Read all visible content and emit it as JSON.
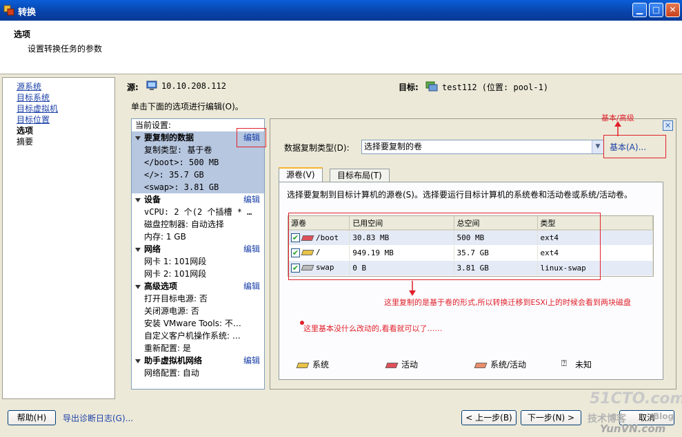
{
  "window": {
    "title": "转换",
    "colors": {
      "titlebar": "#0a5fd8",
      "link": "#1a3fa8",
      "annotation": "#e0202a"
    }
  },
  "header": {
    "title": "选项",
    "subtitle": "设置转换任务的参数"
  },
  "nav": {
    "items": [
      {
        "label": "源系统",
        "state": "link"
      },
      {
        "label": "目标系统",
        "state": "link"
      },
      {
        "label": "目标虚拟机",
        "state": "link"
      },
      {
        "label": "目标位置",
        "state": "link"
      },
      {
        "label": "选项",
        "state": "current"
      },
      {
        "label": "摘要",
        "state": "plain"
      }
    ]
  },
  "source": {
    "label": "源:",
    "value": "10.10.208.112"
  },
  "target": {
    "label": "目标:",
    "value": "test112 (位置: pool-1)"
  },
  "instruction": "单击下面的选项进行编辑(O)。",
  "settings": {
    "header": "当前设置:",
    "edit_label": "编辑",
    "sections": [
      {
        "title": "要复制的数据",
        "editable": true,
        "highlighted": true,
        "lines": [
          "复制类型: 基于卷",
          "</boot>: 500 MB",
          "</>: 35.7 GB",
          "<swap>: 3.81 GB"
        ]
      },
      {
        "title": "设备",
        "editable": true,
        "highlighted": false,
        "lines": [
          "vCPU: 2 个(2 个插槽 * …",
          "磁盘控制器: 自动选择",
          "内存: 1 GB"
        ]
      },
      {
        "title": "网络",
        "editable": true,
        "highlighted": false,
        "lines": [
          "网卡 1: 101网段",
          "网卡 2: 101网段"
        ]
      },
      {
        "title": "高级选项",
        "editable": true,
        "highlighted": false,
        "lines": [
          "打开目标电源: 否",
          "关闭源电源: 否",
          "安装 VMware Tools: 不…",
          "自定义客户机操作系统: …",
          "重新配置: 是"
        ]
      },
      {
        "title": "助手虚拟机网络",
        "editable": true,
        "highlighted": false,
        "lines": [
          "网络配置: 自动"
        ]
      }
    ]
  },
  "panel": {
    "copy_type_label": "数据复制类型(D):",
    "copy_type_value": "选择要复制的卷",
    "mode_button": "基本(A)...",
    "tabs": [
      {
        "label": "源卷(V)",
        "active": true
      },
      {
        "label": "目标布局(T)",
        "active": false
      }
    ],
    "description": "选择要复制到目标计算机的源卷(S)。选择要运行目标计算机的系统卷和活动卷或系统/活动卷。",
    "columns": [
      "源卷",
      "已用空间",
      "总空间",
      "类型"
    ],
    "rows": [
      {
        "checked": true,
        "name": "/boot",
        "used": "30.83 MB",
        "total": "500 MB",
        "type": "ext4",
        "icon": "active"
      },
      {
        "checked": true,
        "name": "/",
        "used": "949.19 MB",
        "total": "35.7 GB",
        "type": "ext4",
        "icon": "system"
      },
      {
        "checked": true,
        "name": "swap",
        "used": "0 B",
        "total": "3.81 GB",
        "type": "linux-swap",
        "icon": "unknown"
      }
    ],
    "legend": [
      {
        "label": "系统",
        "color": "#e8c347"
      },
      {
        "label": "活动",
        "color": "#e0505a"
      },
      {
        "label": "系统/活动",
        "color": "#e98d6a"
      },
      {
        "label": "未知",
        "color": "#bbbbbb"
      }
    ]
  },
  "annotations": {
    "basic_advanced": "基本/高级",
    "volume_note": "这里复制的是基于卷的形式,所以转换迁移到ESXi上的时候会看到两块磁盘",
    "no_change_note": "这里基本没什么改动的,看看就可以了……"
  },
  "footer": {
    "help": "帮助(H)",
    "export_log": "导出诊断日志(G)...",
    "back": "< 上一步(B)",
    "next": "下一步(N) >",
    "cancel": "取消"
  },
  "watermark": {
    "line1": "51CTO.com",
    "line2": "技术博客",
    "line3": "Blog",
    "line4": "YunVN.com"
  }
}
